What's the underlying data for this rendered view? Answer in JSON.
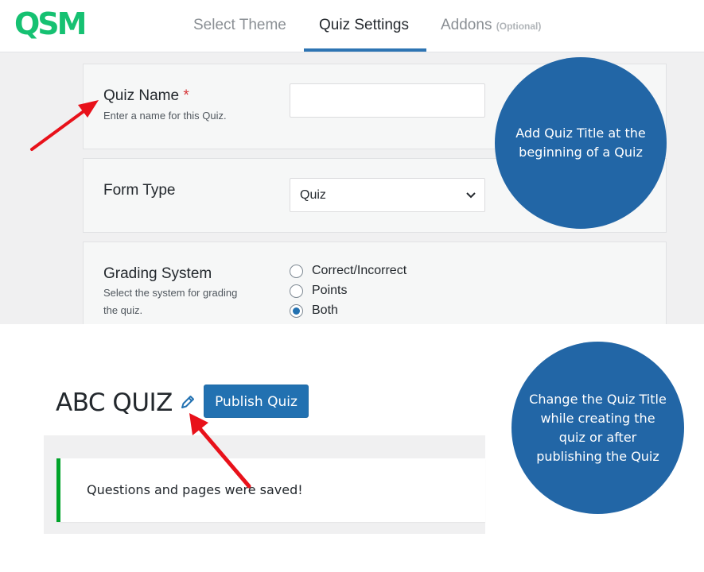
{
  "header": {
    "logo": "QSM",
    "tabs": [
      {
        "label": "Select Theme",
        "suffix": ""
      },
      {
        "label": "Quiz Settings",
        "suffix": ""
      },
      {
        "label": "Addons",
        "suffix": "(Optional)"
      }
    ],
    "active_tab": "Quiz Settings"
  },
  "settings": {
    "quiz_name": {
      "label": "Quiz Name",
      "required": "*",
      "description": "Enter a name for this Quiz.",
      "value": ""
    },
    "form_type": {
      "label": "Form Type",
      "value": "Quiz"
    },
    "grading_system": {
      "label": "Grading System",
      "description": [
        "Select the system for grading",
        "the quiz."
      ],
      "options": [
        "Correct/Incorrect",
        "Points",
        "Both"
      ],
      "selected": "Both"
    }
  },
  "callouts": {
    "top": [
      "Add Quiz Title at the",
      "beginning of a Quiz"
    ],
    "bottom": [
      "Change the Quiz Title",
      "while creating the",
      "quiz or after",
      "publishing the Quiz"
    ]
  },
  "editor": {
    "quiz_title": "ABC QUIZ",
    "publish_button": "Publish Quiz",
    "notice": "Questions and pages were saved!"
  },
  "colors": {
    "logo": "#16c172",
    "accent": "#2271b1",
    "callout": "#2266a6",
    "success": "#00a32a",
    "arrow": "#e8111a"
  },
  "icons": {
    "pencil": "pencil-icon",
    "chevron": "chevron-down-icon"
  }
}
